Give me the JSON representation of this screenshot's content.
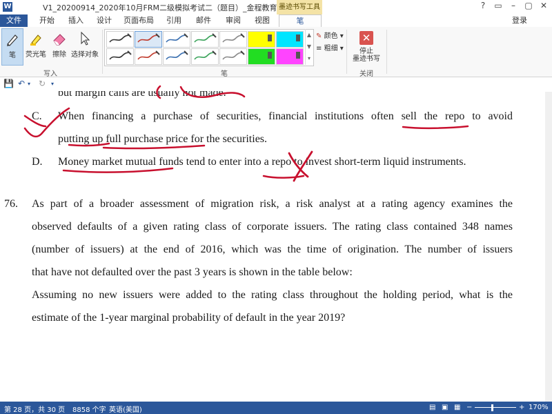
{
  "window": {
    "app_icon": "W",
    "title": "V1_20200914_2020年10月FRM二级模拟考试二（题目）_金程教育 - Word",
    "controls": [
      "?",
      "▭",
      "–",
      "▢",
      "✕"
    ]
  },
  "tabs": [
    "文件",
    "开始",
    "插入",
    "设计",
    "页面布局",
    "引用",
    "邮件",
    "审阅",
    "视图",
    "笔"
  ],
  "contextual_group": "墨迹书写工具",
  "login_label": "登录",
  "ribbon": {
    "write_group": {
      "label": "写入",
      "buttons": [
        "笔",
        "荧光笔",
        "擦除",
        "选择对象"
      ]
    },
    "pens_group": {
      "label": "笔",
      "color_label": "颜色",
      "thickness_label": "粗细"
    },
    "close_group": {
      "label": "关闭",
      "stop_label_1": "停止",
      "stop_label_2": "墨迹书写"
    },
    "pen_colors": [
      "#333333",
      "#c0392b",
      "#3a6fb0",
      "#3aa35a",
      "#8a8a8a",
      "#ffff00",
      "#00e5ff",
      "#333333",
      "#c0392b",
      "#3a6fb0",
      "#3aa35a",
      "#8a8a8a",
      "#22dd22",
      "#ff44ff"
    ]
  },
  "qat": {
    "save": "save-icon",
    "undo": "undo-icon",
    "redo": "redo-icon"
  },
  "document": {
    "partial_line": "but margin calls are usually not made.",
    "option_c_letter": "C.",
    "option_c_line1": "When financing a purchase of securities, financial institutions often sell the repo to avoid",
    "option_c_line2": "putting up full purchase price for the securities.",
    "option_d_letter": "D.",
    "option_d_line1": "Money market mutual funds tend to enter into a repo to invest short-term liquid instruments.",
    "q76_number": "76.",
    "q76_lines": [
      "As part of a broader assessment of migration risk, a risk analyst at a rating agency examines the",
      "observed defaults of a given rating class of corporate issuers. The rating class contained 348 names",
      "(number of issuers) at the end of 2016, which was the time of origination. The number of issuers",
      "that have not defaulted over the past 3 years is shown in the table below:",
      "Assuming no new issuers were added to the rating class throughout the holding period, what is the",
      "estimate of the 1-year marginal probability of default in the year 2019?"
    ]
  },
  "annotation_color": "#c8102e",
  "status": {
    "page": "第 28 页，共 30 页",
    "words": "8858 个字",
    "language": "英语(美国)",
    "zoom": "170%",
    "zoom_minus": "−",
    "zoom_plus": "+"
  }
}
